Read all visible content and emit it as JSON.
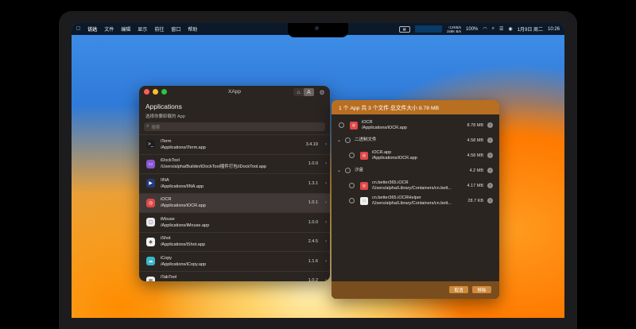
{
  "menubar": {
    "apple": "",
    "items": [
      "访达",
      "文件",
      "编辑",
      "显示",
      "前往",
      "窗口",
      "帮助"
    ],
    "status": {
      "net_up": "↑12KB/s",
      "net_down": "158K B/s",
      "percent": "100%",
      "date": "1月9日 周二",
      "time": "10:26"
    }
  },
  "left_window": {
    "title": "XApp",
    "heading": "Applications",
    "subtitle": "选择你要卸载的 App",
    "search_placeholder": "搜索",
    "apps": [
      {
        "name": "iTerm",
        "path": "/Applications/iTerm.app",
        "version": "3.4.19",
        "color": "#1e1e1e",
        "glyph": ">_"
      },
      {
        "name": "iDockTool",
        "path": "/Users/alpha/Builder/iDockTool插件打包/iDockTool.app",
        "version": "1.0.0",
        "color": "#8a55d6",
        "glyph": "▭"
      },
      {
        "name": "IINA",
        "path": "/Applications/IINA.app",
        "version": "1.3.1",
        "color": "#223a7a",
        "glyph": "▶"
      },
      {
        "name": "iOCR",
        "path": "/Applications/iOCR.app",
        "version": "1.0.1",
        "color": "#e04848",
        "glyph": "◎"
      },
      {
        "name": "iMouse",
        "path": "/Applications/iMouse.app",
        "version": "1.0.0",
        "color": "#e8e8ee",
        "glyph": "◻"
      },
      {
        "name": "iShot",
        "path": "/Applications/iShot.app",
        "version": "2.4.5",
        "color": "#f2f2f2",
        "glyph": "◆"
      },
      {
        "name": "iCopy",
        "path": "/Applications/iCopy.app",
        "version": "1.1.6",
        "color": "#39b7c9",
        "glyph": "☁"
      },
      {
        "name": "iTabTool",
        "path": "/Applications/iTabTool.app",
        "version": "1.0.2",
        "color": "#f0f0f0",
        "glyph": "▦"
      }
    ]
  },
  "right_window": {
    "header": "1 个 App 共 3 个文件 总文件大小 8.78 MB",
    "rows": [
      {
        "name": "iOCR",
        "path": "/Applications/iOCR.app",
        "size": "8.78 MB"
      },
      {
        "name": "二进制文件",
        "path": "",
        "size": "4.58 MB"
      },
      {
        "name": "iOCR.app",
        "path": "/Applications/iOCR.app",
        "size": "4.58 MB"
      },
      {
        "name": "沙盒",
        "path": "",
        "size": "4.2 MB"
      },
      {
        "name": "cn.better365.iOCR",
        "path": "/Users/alpha/Library/Containers/cn.bett...",
        "size": "4.17 MB"
      },
      {
        "name": "cn.better365.iOCRHelper",
        "path": "/Users/alpha/Library/Containers/cn.bett...",
        "size": "28.7 KB"
      }
    ],
    "cancel_label": "取消",
    "remove_label": "移除"
  }
}
